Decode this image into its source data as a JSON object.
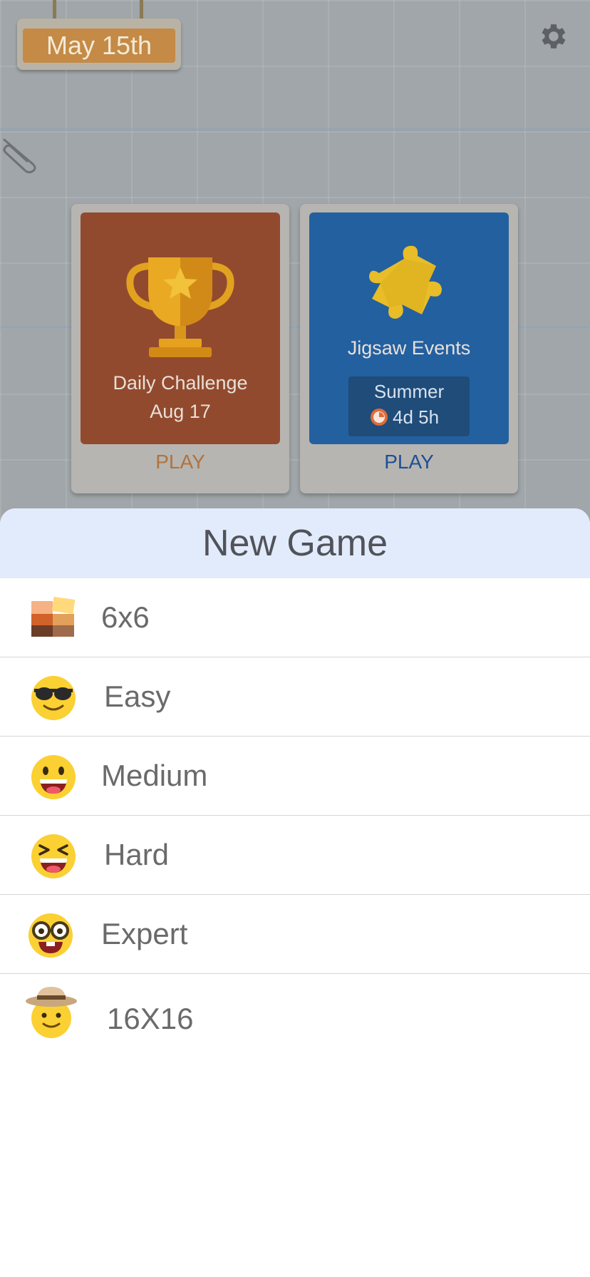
{
  "header": {
    "date": "May 15th"
  },
  "cards": [
    {
      "title": "Daily Challenge",
      "subtitle": "Aug 17",
      "play": "PLAY",
      "face_color": "#924a2e",
      "play_color": "#b0733e"
    },
    {
      "title": "Jigsaw Events",
      "event": "Summer",
      "timer": "4d 5h",
      "play": "PLAY",
      "face_color": "#2360a0",
      "play_color": "#1e4f96"
    }
  ],
  "sheet": {
    "title": "New Game",
    "items": [
      {
        "label": "6x6",
        "icon": "grid-6x6-icon"
      },
      {
        "label": "Easy",
        "icon": "sunglasses-face-icon"
      },
      {
        "label": "Medium",
        "icon": "grinning-face-icon"
      },
      {
        "label": "Hard",
        "icon": "squinting-face-icon"
      },
      {
        "label": "Expert",
        "icon": "nerd-face-icon"
      },
      {
        "label": "16X16",
        "icon": "hat-face-icon"
      }
    ]
  }
}
